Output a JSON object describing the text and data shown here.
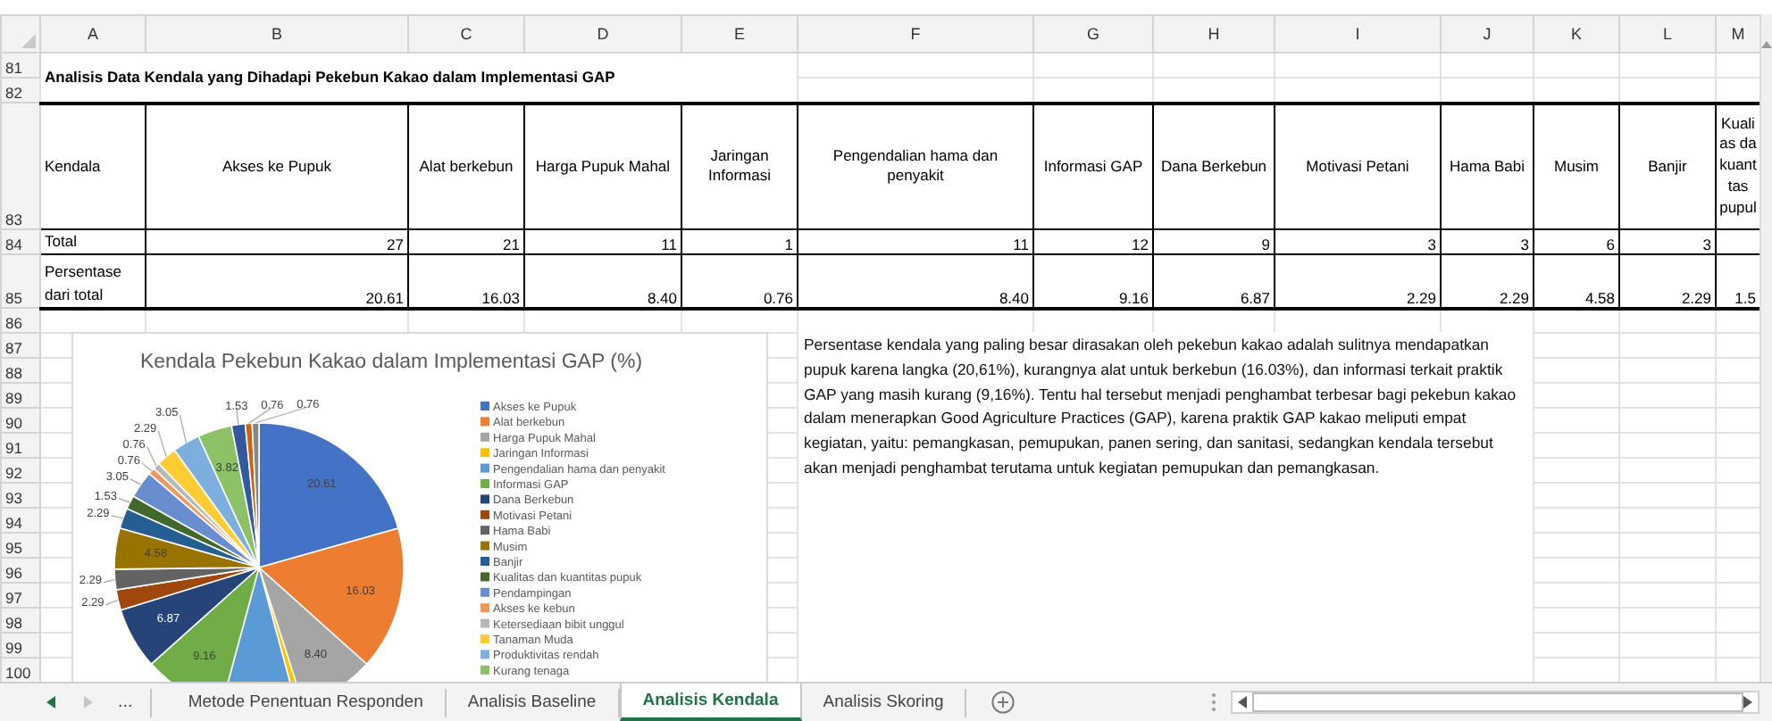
{
  "column_headers": [
    "A",
    "B",
    "C",
    "D",
    "E",
    "F",
    "G",
    "H",
    "I",
    "J",
    "K",
    "L",
    "M"
  ],
  "row_numbers": [
    "81",
    "82",
    "83",
    "84",
    "85",
    "86",
    "87",
    "88",
    "89",
    "90",
    "91",
    "92",
    "93",
    "94",
    "95",
    "96",
    "97",
    "98",
    "99",
    "100"
  ],
  "title": "Analisis Data Kendala yang Dihadapi Pekebun Kakao dalam Implementasi GAP",
  "table": {
    "columns": [
      {
        "label": "Kendala"
      },
      {
        "label": "Akses ke Pupuk"
      },
      {
        "label": "Alat berkebun"
      },
      {
        "label": "Harga Pupuk Mahal"
      },
      {
        "label": "Jaringan Informasi"
      },
      {
        "label": "Pengendalian hama dan penyakit"
      },
      {
        "label": "Informasi GAP"
      },
      {
        "label": "Dana Berkebun"
      },
      {
        "label": "Motivasi Petani"
      },
      {
        "label": "Hama Babi"
      },
      {
        "label": "Musim"
      },
      {
        "label": "Banjir"
      },
      {
        "label": "Kuali as da kuant tas pupul"
      }
    ],
    "rows": [
      {
        "cells": [
          "Total",
          "27",
          "21",
          "11",
          "1",
          "11",
          "12",
          "9",
          "3",
          "3",
          "6",
          "3"
        ]
      },
      {
        "cells": [
          "Persentase dari total",
          "20.61",
          "16.03",
          "8.40",
          "0.76",
          "8.40",
          "9.16",
          "6.87",
          "2.29",
          "2.29",
          "4.58",
          "2.29",
          "1.5"
        ]
      }
    ]
  },
  "chart": {
    "chart_data": {
      "type": "pie",
      "title": "Kendala Pekebun Kakao dalam Implementasi GAP (%)",
      "values": [
        20.61,
        16.03,
        8.4,
        0.76,
        8.4,
        9.16,
        6.87,
        2.29,
        2.29,
        4.58,
        2.29,
        1.53,
        3.05,
        0.76,
        0.76,
        2.29,
        3.05,
        3.82,
        1.53,
        0.76,
        0.76
      ],
      "value_labels": [
        "20.61",
        "16.03",
        "8.40",
        null,
        null,
        "9.16",
        "6.87",
        "2.29",
        "2.29",
        "4.58",
        "2.29",
        "1.53",
        "3.05",
        "0.76",
        "0.76",
        "2.29",
        "3.05",
        "3.82",
        "1.53",
        "0.76",
        "0.76"
      ]
    },
    "legend": [
      "Akses ke Pupuk",
      "Alat berkebun",
      "Harga Pupuk Mahal",
      "Jaringan Informasi",
      "Pengendalian hama dan penyakit",
      "Informasi GAP",
      "Dana Berkebun",
      "Motivasi Petani",
      "Hama Babi",
      "Musim",
      "Banjir",
      "Kualitas dan kuantitas pupuk",
      "Pendampingan",
      "Akses ke kebun",
      "Ketersediaan bibit unggul",
      "Tanaman Muda",
      "Produktivitas rendah",
      "Kurang tenaga"
    ]
  },
  "note": "Persentase kendala yang paling besar dirasakan oleh pekebun kakao adalah sulitnya mendapatkan pupuk karena langka (20,61%), kurangnya alat untuk berkebun (16.03%), dan informasi terkait praktik GAP yang masih kurang (9,16%). Tentu hal tersebut menjadi penghambat terbesar bagi pekebun kakao dalam menerapkan Good Agriculture Practices (GAP), karena praktik GAP kakao meliputi empat kegiatan, yaitu: pemangkasan, pemupukan, panen sering, dan sanitasi, sedangkan kendala tersebut akan menjadi penghambat terutama untuk kegiatan pemupukan dan pemangkasan.",
  "sheet_tabs": {
    "more": "...",
    "tabs": [
      {
        "label": "Metode Penentuan Responden",
        "selected": false
      },
      {
        "label": "Analisis Baseline",
        "selected": false
      },
      {
        "label": "Analisis Kendala",
        "selected": true
      },
      {
        "label": "Analisis Skoring",
        "selected": false
      }
    ]
  }
}
